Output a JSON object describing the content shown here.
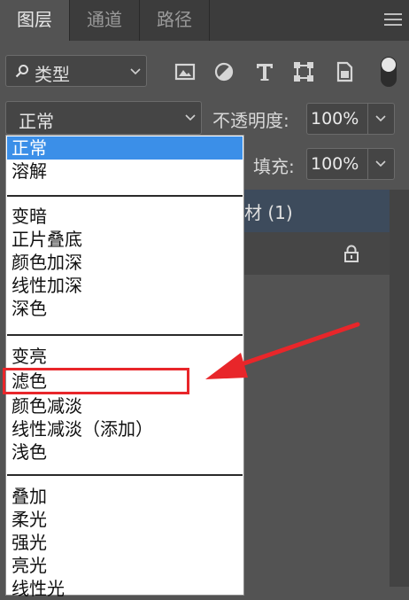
{
  "tabs": [
    "图层",
    "通道",
    "路径"
  ],
  "filter": {
    "label": "类型"
  },
  "blend": {
    "current": "正常",
    "opacity_label": "不透明度:",
    "opacity_value": "100%",
    "fill_label": "填充:",
    "fill_value": "100%"
  },
  "layer": {
    "name_partial": "材 (1)"
  },
  "dropdown": {
    "groups": [
      [
        "正常",
        "溶解"
      ],
      [
        "变暗",
        "正片叠底",
        "颜色加深",
        "线性加深",
        "深色"
      ],
      [
        "变亮",
        "滤色",
        "颜色减淡",
        "线性减淡（添加）",
        "浅色"
      ],
      [
        "叠加",
        "柔光",
        "强光",
        "亮光",
        "线性光"
      ]
    ],
    "selected": "正常",
    "highlighted": "滤色"
  },
  "colors": {
    "selection_blue": "#3b8fe8",
    "annotation_red": "#e8262a",
    "panel_bg": "#535353",
    "layer_selected": "#3d4b5c"
  },
  "icons": [
    "search-icon",
    "image-filter-icon",
    "adjustment-filter-icon",
    "type-filter-icon",
    "shape-filter-icon",
    "smart-object-filter-icon",
    "lock-icon",
    "panel-menu-icon"
  ]
}
